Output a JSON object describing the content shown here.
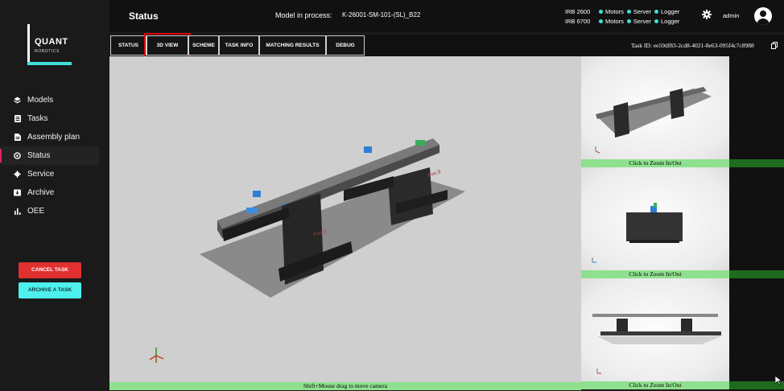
{
  "logo": {
    "name": "QUANT",
    "subtitle": "ROBOTICS"
  },
  "sidebar": {
    "items": [
      {
        "label": "Models",
        "icon": "models-icon"
      },
      {
        "label": "Tasks",
        "icon": "tasks-icon"
      },
      {
        "label": "Assembly plan",
        "icon": "assembly-plan-icon"
      },
      {
        "label": "Status",
        "icon": "status-icon",
        "active": true
      },
      {
        "label": "Service",
        "icon": "gear-icon"
      },
      {
        "label": "Archive",
        "icon": "archive-icon"
      },
      {
        "label": "OEE",
        "icon": "bar-chart-icon"
      }
    ],
    "cancel_label": "CANCEL TASK",
    "archive_label": "ARCHIVE A TASK"
  },
  "header": {
    "title": "Status",
    "model_label": "Model in process:",
    "model_value": "K-26001-SM-101-(SL)_B22",
    "robots": [
      {
        "name": "IRB 2600",
        "statuses": [
          "Motors",
          "Server",
          "Logger"
        ]
      },
      {
        "name": "IRB 6700",
        "statuses": [
          "Motors",
          "Server",
          "Logger"
        ]
      }
    ],
    "user": "admin"
  },
  "tabs": [
    {
      "label": "STATUS"
    },
    {
      "label": "3D VIEW",
      "active": true
    },
    {
      "label": "SCHEME"
    },
    {
      "label": "TASK INFO"
    },
    {
      "label": "MATCHING RESULTS"
    },
    {
      "label": "DEBUG"
    }
  ],
  "task_id": "Task ID: ee59df83-2cd8-4021-8e63-095f4c7c8988",
  "viewport": {
    "hint": "Shift+Mouse drag to move camera",
    "pos_labels": [
      "Pos.3",
      "Pos.9"
    ]
  },
  "thumbnails": {
    "zoom_label": "Click to Zoom In/Out"
  },
  "colors": {
    "accent": "#3ee0d8",
    "active_indicator": "#e0245e",
    "cancel": "#e03030",
    "archive": "#4ef0ec",
    "hint_bar": "#8fe08f",
    "highlight": "#e00000"
  }
}
